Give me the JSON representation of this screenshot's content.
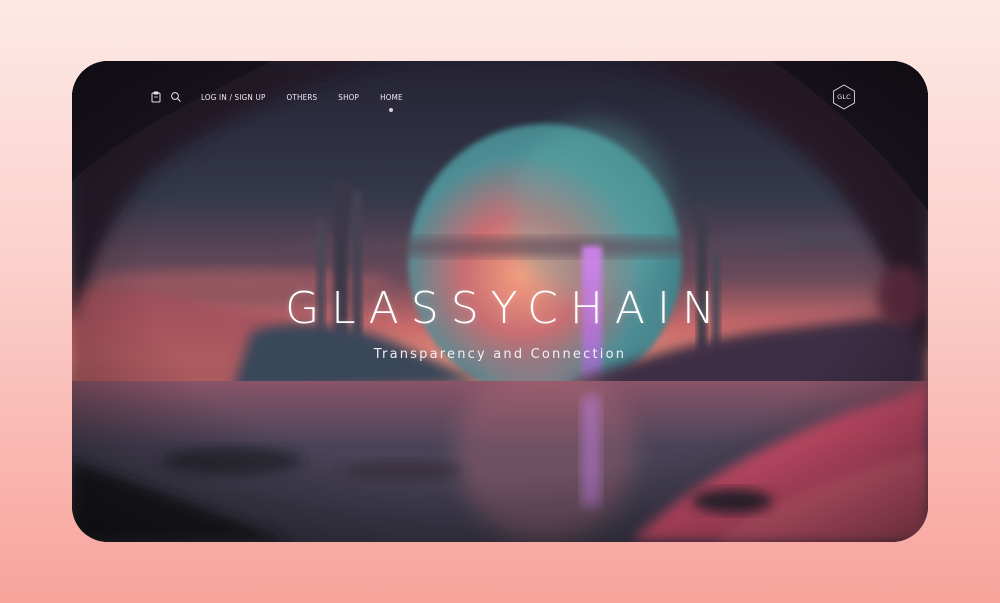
{
  "nav": {
    "links": [
      "LOG IN / SIGN UP",
      "OTHERS",
      "SHOP",
      "HOME"
    ],
    "active_index": 3,
    "icons": [
      "clipboard-icon",
      "search-icon"
    ]
  },
  "logo": {
    "text": "GLC"
  },
  "hero": {
    "title": "GLASSYCHAIN",
    "subtitle": "Transparency and Connection"
  },
  "colors": {
    "page_top": "#fde9e6",
    "page_bottom": "#f8a39c",
    "sky_dark": "#1d1b28",
    "planet_warm": "#f0866e",
    "planet_teal": "#4aa9a4",
    "beam": "#c079f0",
    "ground_pink": "#e9577a"
  }
}
